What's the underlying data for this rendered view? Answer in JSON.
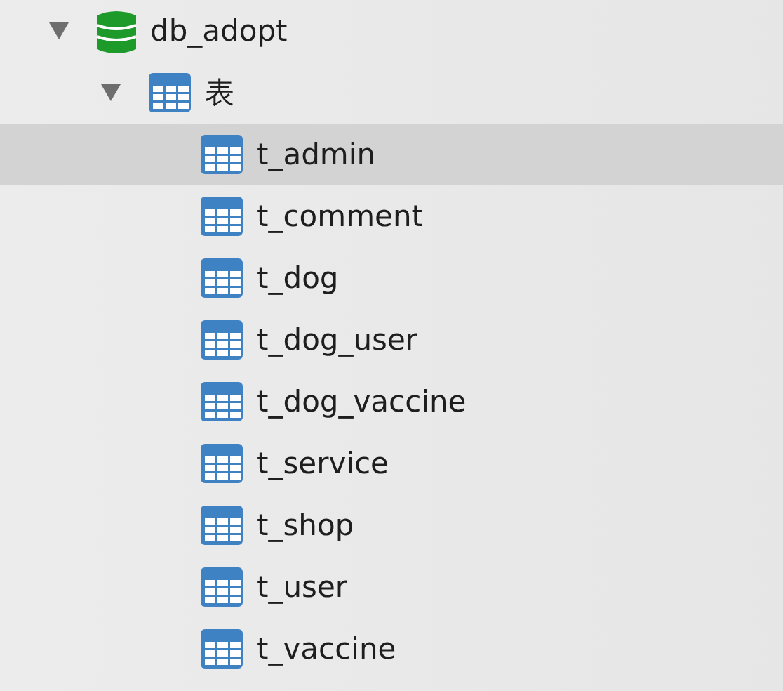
{
  "tree": [
    {
      "kind": "database",
      "label": "db_adopt",
      "expanded": true,
      "selected": false,
      "children": [
        {
          "kind": "table-group",
          "label": "表",
          "expanded": true,
          "selected": false,
          "children": [
            {
              "kind": "table",
              "label": "t_admin",
              "selected": true
            },
            {
              "kind": "table",
              "label": "t_comment",
              "selected": false
            },
            {
              "kind": "table",
              "label": "t_dog",
              "selected": false
            },
            {
              "kind": "table",
              "label": "t_dog_user",
              "selected": false
            },
            {
              "kind": "table",
              "label": "t_dog_vaccine",
              "selected": false
            },
            {
              "kind": "table",
              "label": "t_service",
              "selected": false
            },
            {
              "kind": "table",
              "label": "t_shop",
              "selected": false
            },
            {
              "kind": "table",
              "label": "t_user",
              "selected": false
            },
            {
              "kind": "table",
              "label": "t_vaccine",
              "selected": false
            }
          ]
        }
      ]
    }
  ]
}
